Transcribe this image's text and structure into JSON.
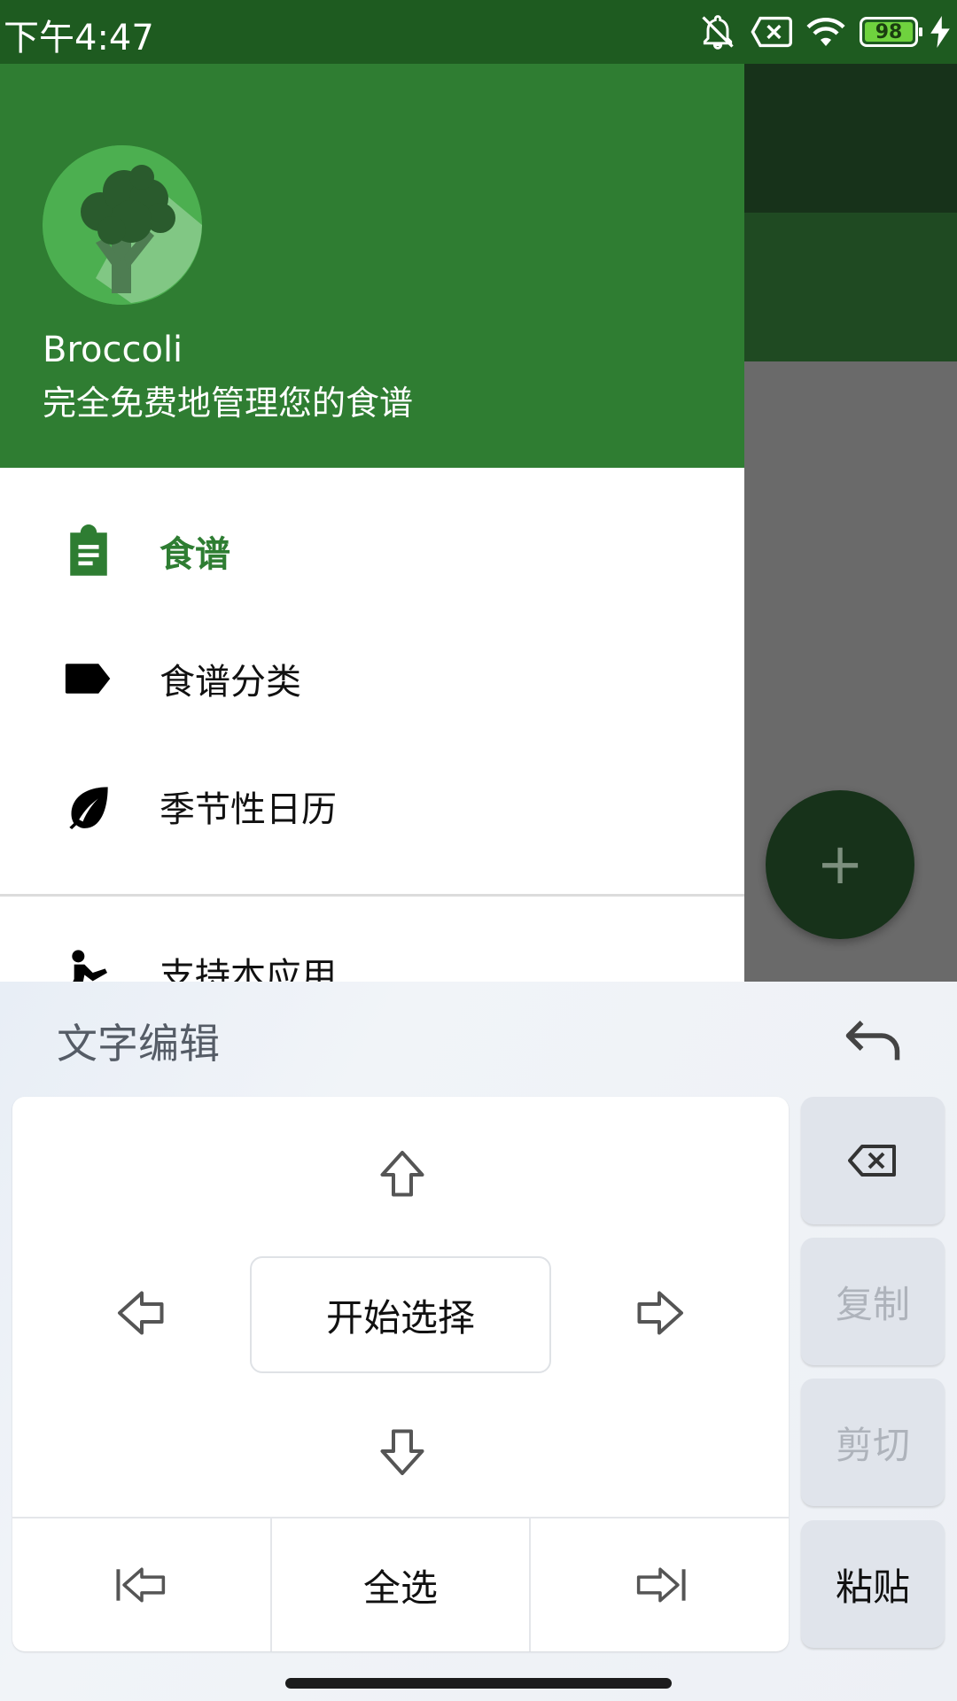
{
  "status_bar": {
    "time": "下午4:47",
    "battery": "98"
  },
  "drawer": {
    "app_name": "Broccoli",
    "tagline": "完全免费地管理您的食谱",
    "items": [
      {
        "label": "食谱",
        "icon": "clipboard-icon",
        "active": true
      },
      {
        "label": "食谱分类",
        "icon": "tag-icon",
        "active": false
      },
      {
        "label": "季节性日历",
        "icon": "leaf-icon",
        "active": false
      },
      {
        "label": "支持本应用",
        "icon": "person-icon",
        "active": false
      }
    ]
  },
  "fab": {
    "symbol": "+"
  },
  "keyboard": {
    "title": "文字编辑",
    "start_select": "开始选择",
    "select_all": "全选",
    "copy": "复制",
    "cut": "剪切",
    "paste": "粘贴"
  },
  "colors": {
    "primary": "#2f7d32",
    "status_bar": "#1e5b20",
    "accent_text": "#2e7d32"
  }
}
